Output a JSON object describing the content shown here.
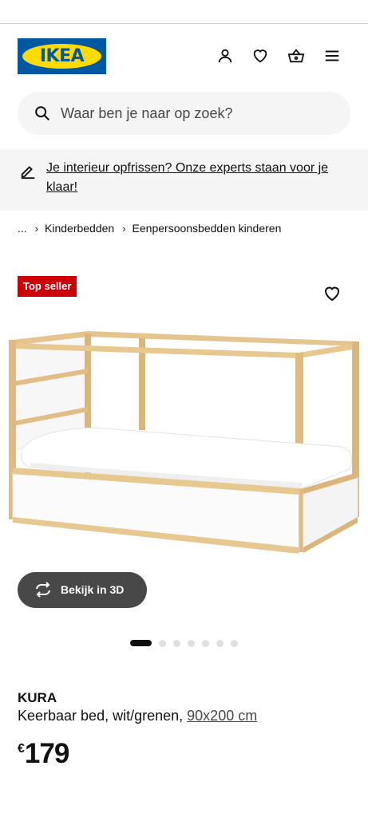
{
  "header": {
    "logo_text": "IKEA",
    "icons": [
      "account-icon",
      "heart-icon",
      "basket-icon",
      "menu-icon"
    ]
  },
  "search": {
    "placeholder": "Waar ben je naar op zoek?"
  },
  "banner": {
    "text": "Je interieur opfrissen? Onze experts staan voor je klaar!"
  },
  "breadcrumb": {
    "ellipsis": "...",
    "items": [
      "Kinderbedden",
      "Eenpersoonsbedden kinderen"
    ]
  },
  "product": {
    "badge": "Top seller",
    "view3d_label": "Bekijk in 3D",
    "gallery_total": 7,
    "gallery_active": 1,
    "name": "KURA",
    "description": "Keerbaar bed, wit/grenen,",
    "size": "90x200 cm",
    "currency": "€",
    "price": "179"
  },
  "colors": {
    "brand_blue": "#0058a3",
    "brand_yellow": "#ffdb00",
    "badge_red": "#cc0008",
    "button_dark": "#484848"
  }
}
